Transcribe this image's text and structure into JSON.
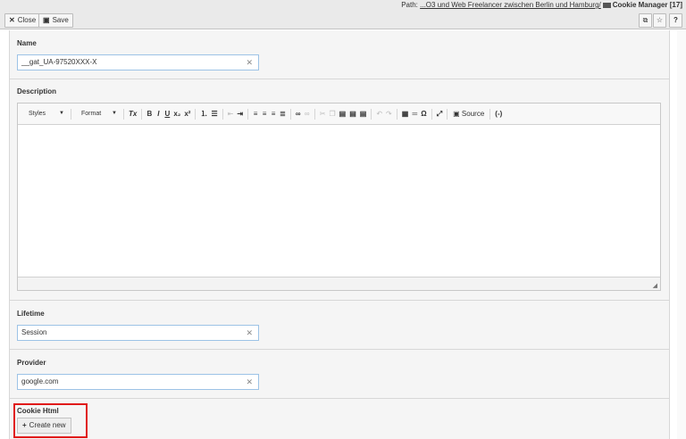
{
  "pathbar": {
    "prefix": "Path: ",
    "path_link": "...O3 und Web Freelancer zwischen Berlin und Hamburg/",
    "module": "Cookie Manager [17]"
  },
  "toolbar": {
    "close_label": "Close",
    "save_label": "Save",
    "help_label": "?"
  },
  "fields": {
    "name": {
      "label": "Name",
      "value": "__gat_UA-97520XXX-X"
    },
    "description": {
      "label": "Description"
    },
    "lifetime": {
      "label": "Lifetime",
      "value": "Session"
    },
    "provider": {
      "label": "Provider",
      "value": "google.com"
    },
    "cookie_html": {
      "label": "Cookie Html",
      "button_label": "Create new"
    }
  },
  "editor": {
    "styles_label": "Styles",
    "format_label": "Format",
    "source_label": "Source",
    "buttons": [
      "Tx",
      "B",
      "I",
      "U",
      "x₂",
      "x²",
      "ol",
      "ul",
      "outdent",
      "indent",
      "align-left",
      "align-center",
      "align-right",
      "justify",
      "link",
      "unlink",
      "cut",
      "copy",
      "paste",
      "paste-text",
      "paste-word",
      "undo",
      "redo",
      "table",
      "hr",
      "Ω",
      "maximize",
      "(-)"
    ]
  },
  "colors": {
    "highlight": "#e01a1a",
    "input_border": "#9dc3e6"
  }
}
